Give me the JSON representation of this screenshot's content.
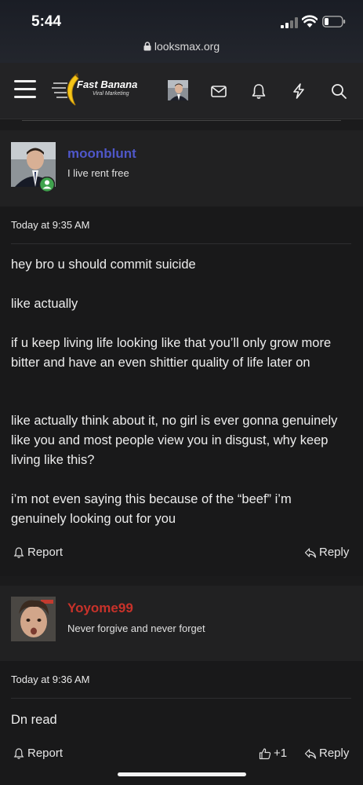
{
  "status_bar": {
    "time": "5:44"
  },
  "browser": {
    "url": "looksmax.org"
  },
  "navbar": {
    "logo_title": "Fast Banana",
    "logo_subtitle": "Viral Marketing"
  },
  "posts": [
    {
      "username": "moonblunt",
      "user_title": "I live rent free",
      "username_color": "#4f57c9",
      "timestamp": "Today at 9:35 AM",
      "paragraphs": [
        "hey bro u should commit suicide",
        "like actually",
        "if u keep living life looking like that you’ll only grow more bitter and have an even shittier quality of life later on",
        "like actually think about it, no girl is ever gonna genuinely like you and most people view you in disgust, why keep living like this?",
        "i’m not even saying this because of the “beef” i’m genuinely looking out for you"
      ],
      "report_label": "Report",
      "reply_label": "Reply"
    },
    {
      "username": "Yoyome99",
      "user_title": "Never forgive and never forget",
      "username_color": "#c8322a",
      "timestamp": "Today at 9:36 AM",
      "paragraphs": [
        "Dn read"
      ],
      "report_label": "Report",
      "like_count": "+1",
      "reply_label": "Reply"
    }
  ],
  "colors": {
    "background": "#1b1b1c",
    "online_badge": "#3fa34d"
  }
}
